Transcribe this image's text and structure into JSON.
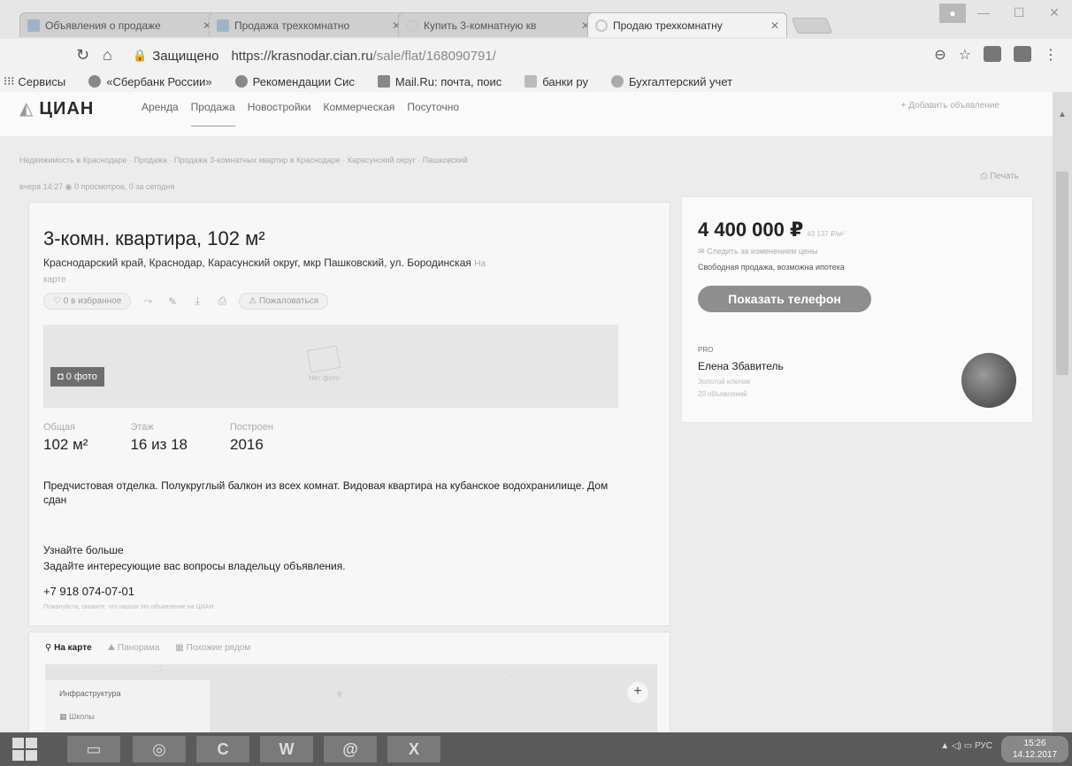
{
  "browser": {
    "tabs": [
      {
        "title": "Объявления о продаже",
        "active": false
      },
      {
        "title": "Продажа трехкомнатно",
        "active": false
      },
      {
        "title": "Купить 3-комнатную кв",
        "active": false
      },
      {
        "title": "Продаю трехкомнатну",
        "active": true
      }
    ],
    "secure_label": "Защищено",
    "url_host": "https://krasnodar.cian.ru",
    "url_path": "/sale/flat/168090791/",
    "bookmarks": [
      {
        "label": "Сервисы"
      },
      {
        "label": "«Сбербанк России»"
      },
      {
        "label": "Рекомендации Сис"
      },
      {
        "label": "Mail.Ru: почта, поис"
      },
      {
        "label": "банки ру"
      },
      {
        "label": "Бухгалтерский учет"
      }
    ]
  },
  "site": {
    "logo": "ЦИАН",
    "menu": [
      "Аренда",
      "Продажа",
      "Новостройки",
      "Коммерческая",
      "Посуточно"
    ],
    "add_listing": "+ Добавить объявление"
  },
  "breadcrumbs": "Недвижимость в Краснодаре  ·  Продажа  ·  Продажа 3-комнатных квартир в Краснодаре  ·  Карасунский округ  ·  Пашковский",
  "meta": "вчера 14:27   ◉ 0 просмотров, 0 за сегодня",
  "print_label": "Печать",
  "listing": {
    "title": "3-комн. квартира, 102 м²",
    "address": "Краснодарский край, Краснодар, Карасунский округ, мкр Пашковский, ул. Бородинская",
    "map_link": "На карте",
    "favorite": "0 в избранное",
    "complain": "Пожаловаться",
    "photo_badge": "0 фото",
    "no_photo": "Нет фото",
    "facts": [
      {
        "label": "Общая",
        "value": "102 м²"
      },
      {
        "label": "Этаж",
        "value": "16 из 18"
      },
      {
        "label": "Построен",
        "value": "2016"
      }
    ],
    "description": "Предчистовая отделка. Полукруглый балкон из всех комнат. Видовая квартира на кубанское водохранилище. Дом сдан",
    "more_heading": "Узнайте больше",
    "more_text": "Задайте интересующие вас вопросы владельцу объявления.",
    "phone": "+7 918 074-07-01",
    "phone_note": "Пожалуйста, скажите, что нашли это объявление на ЦИАН"
  },
  "map": {
    "tabs": [
      "На карте",
      "Панорама",
      "Похожие рядом"
    ],
    "infra_title": "Инфраструктура",
    "infra_item": "Школы"
  },
  "sidebar": {
    "price": "4 400 000 ₽",
    "price_per_m": "43 137 ₽/м²",
    "follow": "Следить за изменением цены",
    "sale_type": "Свободная продажа, возможна ипотека",
    "show_phone": "Показать телефон",
    "pro": "PRO",
    "agent_name": "Елена Збавитель",
    "agent_status": "Золотой ключик",
    "agent_count": "20 объявлений"
  },
  "taskbar": {
    "lang": "РУС",
    "time": "15:26",
    "date": "14.12.2017"
  }
}
